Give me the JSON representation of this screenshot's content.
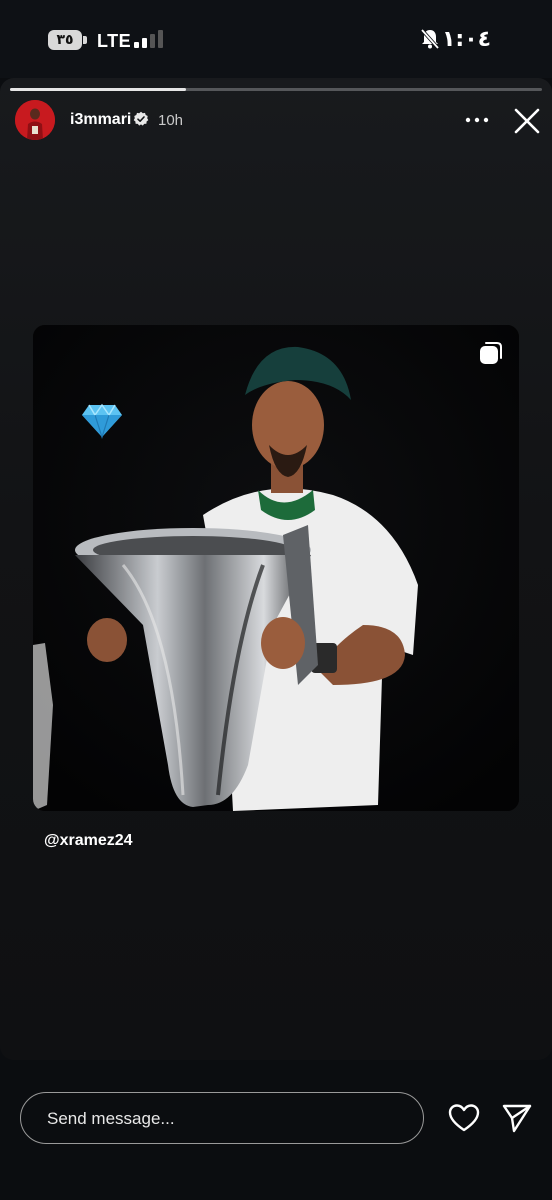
{
  "status_bar": {
    "battery": "٣٥",
    "network": "LTE",
    "time": "١:٠٤"
  },
  "story": {
    "progress": 0.33,
    "username": "i3mmari",
    "timestamp": "10h",
    "mention": "@xramez24"
  },
  "reply": {
    "placeholder": "Send message..."
  },
  "colors": {
    "background": "#0b0d10",
    "card": "#151719",
    "progress_fill": "#e6e6e6",
    "avatar_bg": "#c81a1f"
  },
  "icons": [
    "signal-icon",
    "muted-bell-icon",
    "verified-icon",
    "more-icon",
    "close-icon",
    "diamond-icon",
    "carousel-icon",
    "heart-icon",
    "send-icon"
  ]
}
